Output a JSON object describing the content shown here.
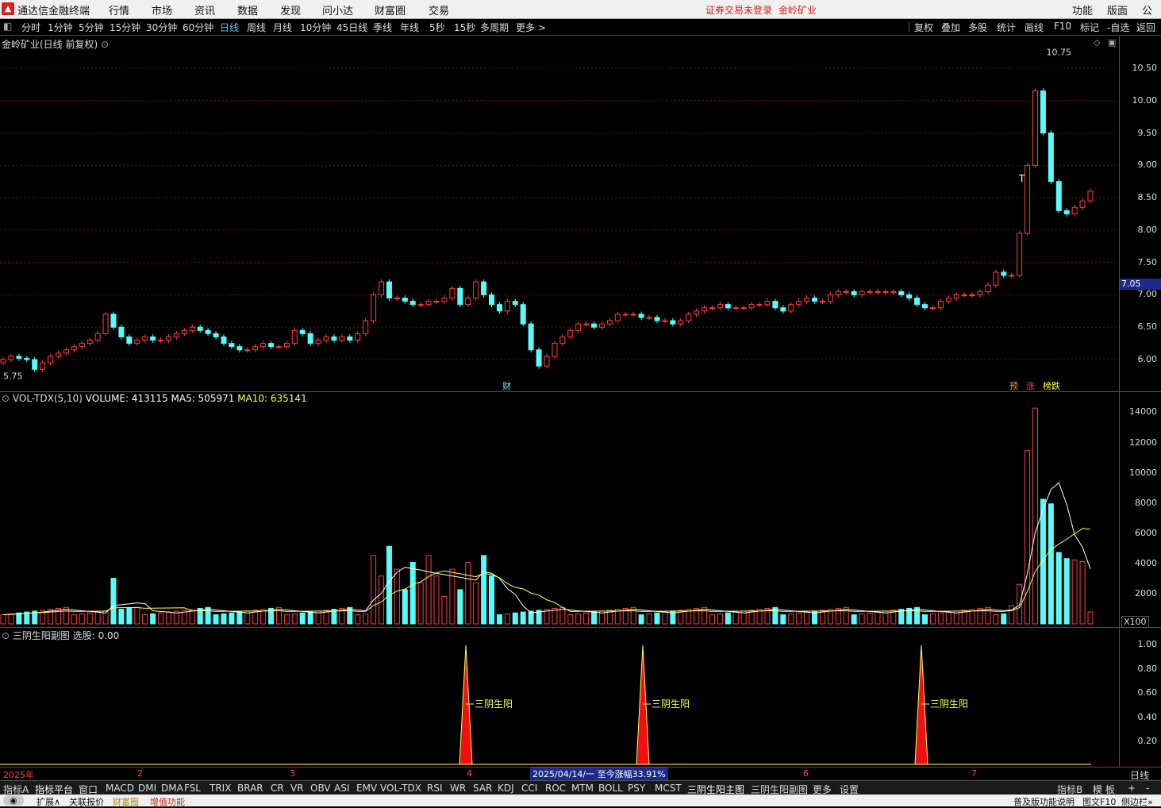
{
  "menu": {
    "app_title": "通达信金融终端",
    "items": [
      "行情",
      "市场",
      "资讯",
      "数据",
      "发现",
      "问小达",
      "财富圈",
      "交易"
    ],
    "alert_login": "证券交易未登录",
    "alert_stock": "金岭矿业",
    "right_items": [
      "功能",
      "版面",
      "公式"
    ]
  },
  "periods": {
    "items": [
      "分时",
      "1分钟",
      "5分钟",
      "15分钟",
      "30分钟",
      "60分钟",
      "日线",
      "周线",
      "月线",
      "10分钟",
      "45日线",
      "季线",
      "年线",
      "5秒",
      "15秒",
      "多周期",
      "更多 >"
    ],
    "active": "日线",
    "right_buttons": [
      "复权",
      "叠加",
      "多股",
      "统计",
      "画线",
      "F10",
      "标记",
      "-自选",
      "返回"
    ]
  },
  "main_panel": {
    "title": "金岭矿业(日线 前复权)",
    "y_labels": [
      "10.50",
      "10.00",
      "9.50",
      "9.00",
      "8.50",
      "8.00",
      "7.50",
      "7.00",
      "6.50",
      "6.00"
    ],
    "current_price": "7.05",
    "high_label": "10.75",
    "low_label": "5.75",
    "marker_cai": "财",
    "marker_yu": "预",
    "marker_zhang": "涨",
    "marker_bang": "榜跌",
    "marker_t": "T",
    "colors": {
      "up": "#ff3c3c",
      "down": "#54fcfc"
    }
  },
  "vol_panel": {
    "name": "VOL-TDX(5,10)",
    "volume": "VOLUME: 413115",
    "ma5": "MA5: 505971",
    "ma10": "MA10: 635141",
    "y_labels": [
      "14000",
      "12000",
      "10000",
      "8000",
      "6000",
      "4000",
      "2000"
    ],
    "unit": "X100"
  },
  "sub_panel": {
    "name": "三阴生阳副图",
    "select": "选股: 0.00",
    "y_labels": [
      "1.00",
      "0.80",
      "0.60",
      "0.40",
      "0.20"
    ],
    "signal_label": "三阴生阳"
  },
  "date_axis": {
    "labels": [
      "2025年",
      "2",
      "3",
      "4",
      "6",
      "7"
    ],
    "cursor": "2025/04/14/一  至今涨幅33.91%",
    "period": "日线"
  },
  "indicators": {
    "items": [
      "指标A",
      "指标平台",
      "窗口",
      "MACD",
      "DMI",
      "DMA",
      "FSL",
      "TRIX",
      "BRAR",
      "CR",
      "VR",
      "OBV",
      "ASI",
      "EMV",
      "VOL-TDX",
      "RSI",
      "WR",
      "SAR",
      "KDJ",
      "CCI",
      "ROC",
      "MTM",
      "BOLL",
      "PSY",
      "MCST",
      "三阴生阳主图",
      "三阴生阳副图",
      "更多",
      "设置"
    ],
    "right": [
      "指标B",
      "模 板",
      "+",
      "-"
    ]
  },
  "status": {
    "items": [
      "扩展∧",
      "关联报价",
      "财富圈",
      "增值功能"
    ],
    "right": [
      "普及版功能说明",
      "图文F10",
      "侧边栏»"
    ]
  },
  "chart_data": {
    "type": "candlestick",
    "ylim": [
      5.75,
      10.75
    ],
    "series": [
      {
        "name": "K",
        "open": [
          5.95,
          6.0,
          6.05,
          6.02,
          6.0,
          5.85,
          5.95,
          6.05,
          6.1,
          6.15,
          6.2,
          6.25,
          6.3,
          6.4,
          6.7,
          6.5,
          6.35,
          6.25,
          6.3,
          6.35,
          6.3,
          6.3,
          6.35,
          6.4,
          6.45,
          6.5,
          6.45,
          6.4,
          6.35,
          6.25,
          6.2,
          6.15,
          6.15,
          6.2,
          6.25,
          6.2,
          6.2,
          6.25,
          6.45,
          6.4,
          6.25,
          6.3,
          6.35,
          6.3,
          6.35,
          6.3,
          6.4,
          6.6,
          7.0,
          7.2,
          6.95,
          6.95,
          6.9,
          6.85,
          6.85,
          6.9,
          6.9,
          6.95,
          7.1,
          6.85,
          6.95,
          7.2,
          7.0,
          6.85,
          6.75,
          6.9,
          6.85,
          6.55,
          6.15,
          5.9,
          6.05,
          6.25,
          6.35,
          6.45,
          6.55,
          6.55,
          6.5,
          6.55,
          6.6,
          6.7,
          6.7,
          6.7,
          6.65,
          6.65,
          6.6,
          6.6,
          6.55,
          6.6,
          6.7,
          6.75,
          6.8,
          6.8,
          6.85,
          6.8,
          6.8,
          6.8,
          6.85,
          6.85,
          6.9,
          6.8,
          6.75,
          6.85,
          6.9,
          6.95,
          6.9,
          6.9,
          7.0,
          7.05,
          7.05,
          7.0,
          7.05,
          7.05,
          7.05,
          7.05,
          7.05,
          7.0,
          6.95,
          6.85,
          6.8,
          6.8,
          6.9,
          6.95,
          7.0,
          7.0,
          7.0,
          7.05,
          7.15,
          7.35,
          7.3,
          7.3,
          7.95,
          9.0,
          10.15,
          9.5,
          8.75,
          8.3,
          8.25,
          8.35,
          8.45
        ],
        "close": [
          6.0,
          6.05,
          6.02,
          6.0,
          5.85,
          5.95,
          6.05,
          6.1,
          6.15,
          6.2,
          6.25,
          6.3,
          6.4,
          6.7,
          6.5,
          6.35,
          6.25,
          6.3,
          6.35,
          6.3,
          6.3,
          6.35,
          6.4,
          6.45,
          6.5,
          6.45,
          6.4,
          6.35,
          6.25,
          6.2,
          6.15,
          6.15,
          6.2,
          6.25,
          6.2,
          6.2,
          6.25,
          6.45,
          6.4,
          6.25,
          6.3,
          6.35,
          6.3,
          6.35,
          6.3,
          6.4,
          6.6,
          7.0,
          7.2,
          6.95,
          6.95,
          6.9,
          6.85,
          6.85,
          6.9,
          6.9,
          6.95,
          7.1,
          6.85,
          6.95,
          7.2,
          7.0,
          6.85,
          6.75,
          6.9,
          6.85,
          6.55,
          6.15,
          5.9,
          6.05,
          6.25,
          6.35,
          6.45,
          6.55,
          6.55,
          6.5,
          6.55,
          6.6,
          6.7,
          6.7,
          6.7,
          6.65,
          6.65,
          6.6,
          6.6,
          6.55,
          6.6,
          6.7,
          6.75,
          6.8,
          6.8,
          6.85,
          6.8,
          6.8,
          6.8,
          6.85,
          6.85,
          6.9,
          6.8,
          6.75,
          6.85,
          6.9,
          6.95,
          6.9,
          6.9,
          7.0,
          7.05,
          7.05,
          7.0,
          7.05,
          7.05,
          7.05,
          7.05,
          7.05,
          7.0,
          6.95,
          6.85,
          6.8,
          6.8,
          6.9,
          6.95,
          7.0,
          7.0,
          7.0,
          7.05,
          7.15,
          7.35,
          7.3,
          7.3,
          7.95,
          9.0,
          10.15,
          9.5,
          8.75,
          8.3,
          8.25,
          8.35,
          8.45,
          8.6
        ]
      }
    ]
  }
}
